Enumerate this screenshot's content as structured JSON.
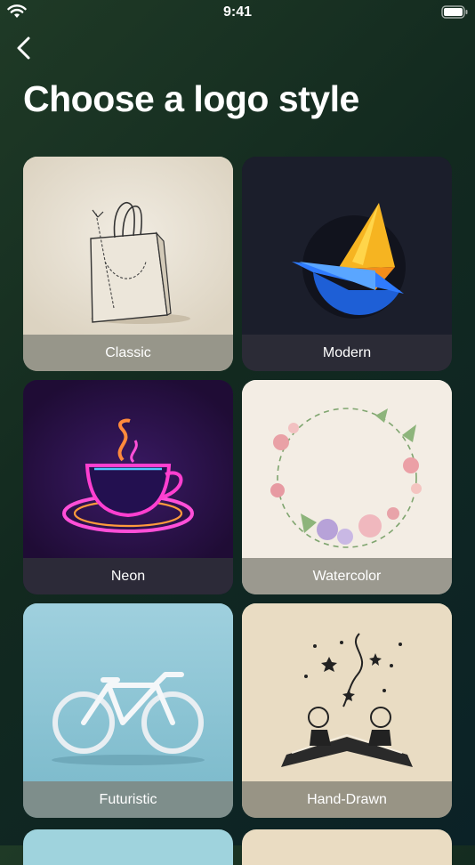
{
  "status_bar": {
    "time": "9:41"
  },
  "header": {
    "title": "Choose a logo style"
  },
  "styles": [
    {
      "label": "Classic",
      "theme": "light",
      "bg": "#e7e0d2"
    },
    {
      "label": "Modern",
      "theme": "dark",
      "bg": "#1b1e2b"
    },
    {
      "label": "Neon",
      "theme": "dark",
      "bg": "#2a1240"
    },
    {
      "label": "Watercolor",
      "theme": "light",
      "bg": "#f3ede4"
    },
    {
      "label": "Futuristic",
      "theme": "light",
      "bg": "#8cc6d6"
    },
    {
      "label": "Hand-Drawn",
      "theme": "light",
      "bg": "#e9dcc3"
    }
  ],
  "peek_colors": [
    "#9fd3dd",
    "#eadcc2"
  ]
}
